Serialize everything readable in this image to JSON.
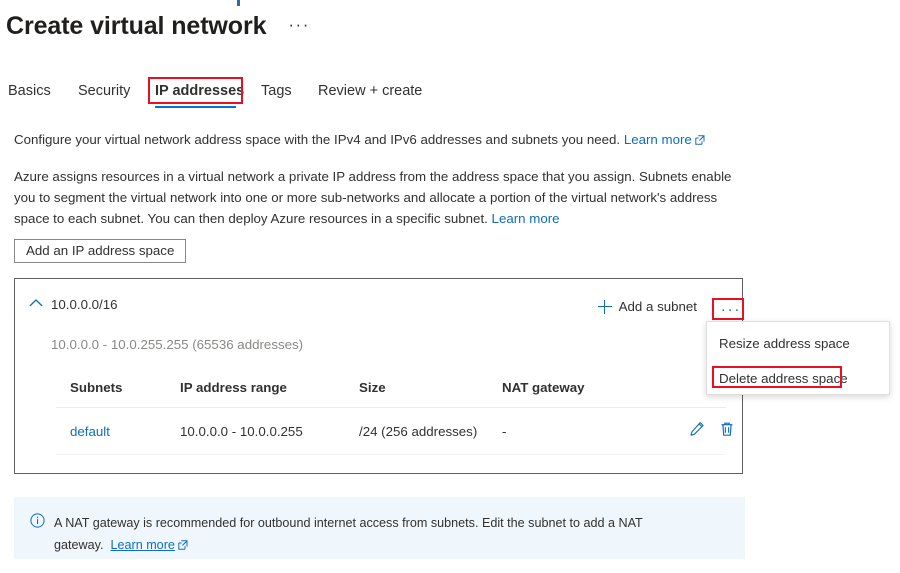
{
  "header": {
    "title": "Create virtual network",
    "ellipsis": "···"
  },
  "tabs": {
    "items": [
      {
        "label": "Basics",
        "selected": false
      },
      {
        "label": "Security",
        "selected": false
      },
      {
        "label": "IP addresses",
        "selected": true
      },
      {
        "label": "Tags",
        "selected": false
      },
      {
        "label": "Review + create",
        "selected": false
      }
    ]
  },
  "description": {
    "paragraph1": "Configure your virtual network address space with the IPv4 and IPv6 addresses and subnets you need.",
    "paragraph1_link": "Learn more",
    "paragraph2": "Azure assigns resources in a virtual network a private IP address from the address space that you assign. Subnets enable you to segment the virtual network into one or more sub-networks and allocate a portion of the virtual network's address space to each subnet. You can then deploy Azure resources in a specific subnet.",
    "paragraph2_link": "Learn more"
  },
  "actions": {
    "add_address_space": "Add an IP address space"
  },
  "address_space": {
    "cidr": "10.0.0.0/16",
    "range_summary": "10.0.0.0 - 10.0.255.255 (65536 addresses)",
    "add_subnet_label": "Add a subnet",
    "more_label": "···",
    "collapse_icon": "chevron-up-icon"
  },
  "context_menu": {
    "items": [
      {
        "label": "Resize address space",
        "highlighted": false
      },
      {
        "label": "Delete address space",
        "highlighted": true
      }
    ]
  },
  "subnets_table": {
    "columns": [
      "Subnets",
      "IP address range",
      "Size",
      "NAT gateway"
    ],
    "rows": [
      {
        "name": "default",
        "ip_range": "10.0.0.0 - 10.0.0.255",
        "size": "/24 (256 addresses)",
        "nat_gateway": "-"
      }
    ]
  },
  "banner": {
    "text": "A NAT gateway is recommended for outbound internet access from subnets. Edit the subnet to add a NAT gateway.",
    "link": "Learn more"
  },
  "colors": {
    "accent_blue": "#0078d4",
    "link_blue": "#0f6cbd",
    "highlight_red": "#e81123",
    "banner_bg": "#eff6fc",
    "panel_border": "#605e5c",
    "muted_text": "#8a8886"
  }
}
